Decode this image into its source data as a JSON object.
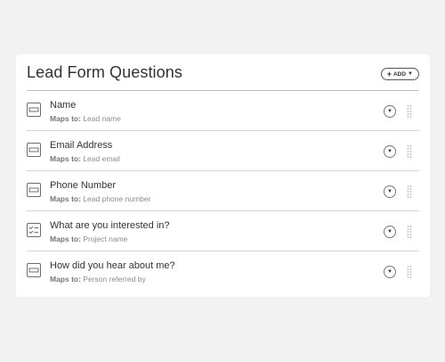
{
  "header": {
    "title": "Lead Form Questions",
    "add_label": "ADD"
  },
  "questions": [
    {
      "label": "Name",
      "maps_key": "Maps to:",
      "maps_value": "Lead name",
      "icon": "text-field-icon"
    },
    {
      "label": "Email Address",
      "maps_key": "Maps to:",
      "maps_value": "Lead email",
      "icon": "text-field-icon"
    },
    {
      "label": "Phone Number",
      "maps_key": "Maps to:",
      "maps_value": "Lead phone number",
      "icon": "text-field-icon"
    },
    {
      "label": "What are you interested in?",
      "maps_key": "Maps to:",
      "maps_value": "Project name",
      "icon": "checklist-icon"
    },
    {
      "label": "How did you hear about me?",
      "maps_key": "Maps to:",
      "maps_value": "Person referred by",
      "icon": "text-field-icon"
    }
  ],
  "colors": {
    "background": "#f2f2f2",
    "panel": "#ffffff",
    "text": "#333333",
    "muted": "#8c8c8c",
    "divider": "#d4d4d4"
  }
}
